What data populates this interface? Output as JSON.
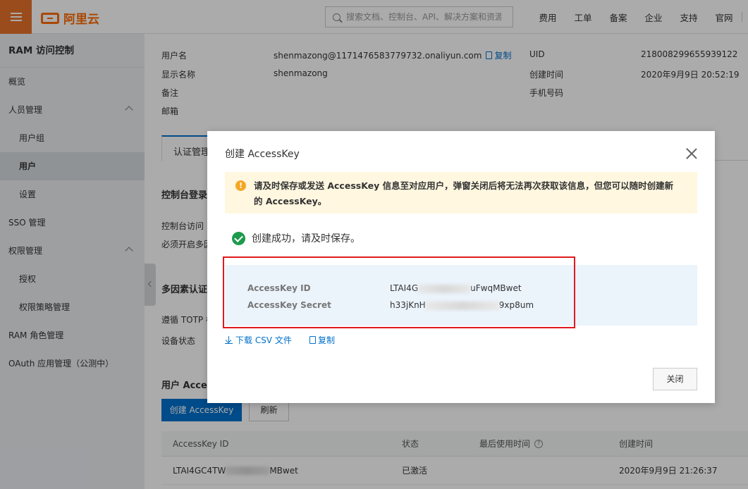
{
  "topbar": {
    "logo_text": "阿里云",
    "search_placeholder": "搜索文档、控制台、API、解决方案和资源",
    "nav": [
      "费用",
      "工单",
      "备案",
      "企业",
      "支持",
      "官网"
    ]
  },
  "sidebar": {
    "title": "RAM 访问控制",
    "items": [
      {
        "label": "概览"
      },
      {
        "label": "人员管理"
      },
      {
        "label": "用户组"
      },
      {
        "label": "用户"
      },
      {
        "label": "设置"
      },
      {
        "label": "SSO 管理"
      },
      {
        "label": "权限管理"
      },
      {
        "label": "授权"
      },
      {
        "label": "权限策略管理"
      },
      {
        "label": "RAM 角色管理"
      },
      {
        "label": "OAuth 应用管理（公测中）"
      }
    ]
  },
  "user_info": {
    "username_label": "用户名",
    "username_value": "shenmazong@1171476583779732.onaliyun.com",
    "copy_label": "复制",
    "display_name_label": "显示名称",
    "display_name_value": "shenmazong",
    "note_label": "备注",
    "email_label": "邮箱",
    "uid_label": "UID",
    "uid_value": "218008299655939122",
    "created_label": "创建时间",
    "created_value": "2020年9月9日 20:52:19",
    "phone_label": "手机号码"
  },
  "main": {
    "tab_label": "认证管理",
    "console_login_heading": "控制台登录",
    "console_access_label": "控制台访问",
    "mfa_required_label": "必须开启多因",
    "mfa_heading": "多因素认证",
    "totp_label": "遵循 TOTP 标",
    "device_status_label": "设备状态",
    "user_ak_heading": "用户 Access",
    "create_ak_button": "创建 AccessKey",
    "refresh_button": "刷新"
  },
  "ak_table": {
    "columns": [
      "AccessKey ID",
      "状态",
      "最后使用时间",
      "创建时间"
    ],
    "rows": [
      {
        "id_prefix": "LTAI4GC4TW",
        "id_suffix": "MBwet",
        "status": "已激活",
        "last_used": "",
        "created": "2020年9月9日 21:26:37"
      }
    ]
  },
  "modal": {
    "title": "创建 AccessKey",
    "warning": "请及时保存或发送 AccessKey 信息至对应用户，弹窗关闭后将无法再次获取该信息，但您可以随时创建新的 AccessKey。",
    "success": "创建成功，请及时保存。",
    "ak_id_label": "AccessKey ID",
    "ak_id_prefix": "LTAI4G",
    "ak_id_suffix": "uFwqMBwet",
    "ak_secret_label": "AccessKey Secret",
    "ak_secret_prefix": "h33jKnH",
    "ak_secret_suffix": "9xp8um",
    "download_label": "下载 CSV 文件",
    "copy_label": "复制",
    "close_label": "关闭"
  },
  "colors": {
    "brand": "#ff6a00",
    "primary": "#0070cc",
    "success": "#1e9a4c",
    "warning": "#f5a623",
    "highlight": "#e0191e"
  }
}
